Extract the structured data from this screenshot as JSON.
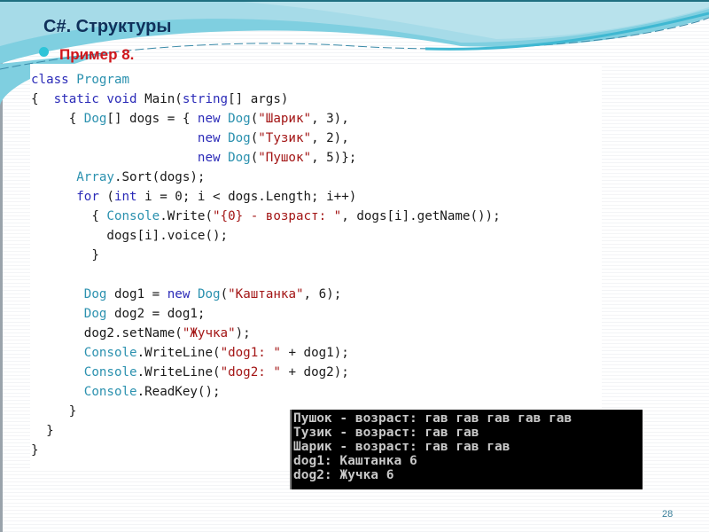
{
  "slide": {
    "title": "C#. Структуры",
    "subtitle": "Пример 8.",
    "page_number": "28",
    "colors": {
      "title": "#10305a",
      "subtitle": "#d0161b",
      "bullet": "#2ec4d8",
      "header_wave": "#7fcfe0"
    }
  },
  "code": {
    "lines": [
      [
        {
          "t": "class ",
          "c": "kw"
        },
        {
          "t": "Program",
          "c": "ty"
        }
      ],
      [
        {
          "t": "{  ",
          "c": ""
        },
        {
          "t": "static void ",
          "c": "kw"
        },
        {
          "t": "Main(",
          "c": ""
        },
        {
          "t": "string",
          "c": "kw"
        },
        {
          "t": "[] args)",
          "c": ""
        }
      ],
      [
        {
          "t": "     { ",
          "c": ""
        },
        {
          "t": "Dog",
          "c": "ty"
        },
        {
          "t": "[] dogs = { ",
          "c": ""
        },
        {
          "t": "new ",
          "c": "kw"
        },
        {
          "t": "Dog",
          "c": "ty"
        },
        {
          "t": "(",
          "c": ""
        },
        {
          "t": "\"Шарик\"",
          "c": "st"
        },
        {
          "t": ", 3),",
          "c": ""
        }
      ],
      [
        {
          "t": "                      ",
          "c": ""
        },
        {
          "t": "new ",
          "c": "kw"
        },
        {
          "t": "Dog",
          "c": "ty"
        },
        {
          "t": "(",
          "c": ""
        },
        {
          "t": "\"Тузик\"",
          "c": "st"
        },
        {
          "t": ", 2),",
          "c": ""
        }
      ],
      [
        {
          "t": "                      ",
          "c": ""
        },
        {
          "t": "new ",
          "c": "kw"
        },
        {
          "t": "Dog",
          "c": "ty"
        },
        {
          "t": "(",
          "c": ""
        },
        {
          "t": "\"Пушок\"",
          "c": "st"
        },
        {
          "t": ", 5)};",
          "c": ""
        }
      ],
      [
        {
          "t": "      ",
          "c": ""
        },
        {
          "t": "Array",
          "c": "ty"
        },
        {
          "t": ".Sort(dogs);",
          "c": ""
        }
      ],
      [
        {
          "t": "      ",
          "c": ""
        },
        {
          "t": "for ",
          "c": "kw"
        },
        {
          "t": "(",
          "c": ""
        },
        {
          "t": "int ",
          "c": "kw"
        },
        {
          "t": "i = 0; i < dogs.Length; i++)",
          "c": ""
        }
      ],
      [
        {
          "t": "        { ",
          "c": ""
        },
        {
          "t": "Console",
          "c": "ty"
        },
        {
          "t": ".Write(",
          "c": ""
        },
        {
          "t": "\"{0} - возраст: \"",
          "c": "st"
        },
        {
          "t": ", dogs[i].getName());",
          "c": ""
        }
      ],
      [
        {
          "t": "          dogs[i].voice();",
          "c": ""
        }
      ],
      [
        {
          "t": "        }",
          "c": ""
        }
      ],
      [
        {
          "t": "",
          "c": ""
        }
      ],
      [
        {
          "t": "       ",
          "c": ""
        },
        {
          "t": "Dog ",
          "c": "ty"
        },
        {
          "t": "dog1 = ",
          "c": ""
        },
        {
          "t": "new ",
          "c": "kw"
        },
        {
          "t": "Dog",
          "c": "ty"
        },
        {
          "t": "(",
          "c": ""
        },
        {
          "t": "\"Каштанка\"",
          "c": "st"
        },
        {
          "t": ", 6);",
          "c": ""
        }
      ],
      [
        {
          "t": "       ",
          "c": ""
        },
        {
          "t": "Dog ",
          "c": "ty"
        },
        {
          "t": "dog2 = dog1;",
          "c": ""
        }
      ],
      [
        {
          "t": "       dog2.setName(",
          "c": ""
        },
        {
          "t": "\"Жучка\"",
          "c": "st"
        },
        {
          "t": ");",
          "c": ""
        }
      ],
      [
        {
          "t": "       ",
          "c": ""
        },
        {
          "t": "Console",
          "c": "ty"
        },
        {
          "t": ".WriteLine(",
          "c": ""
        },
        {
          "t": "\"dog1: \"",
          "c": "st"
        },
        {
          "t": " + dog1);",
          "c": ""
        }
      ],
      [
        {
          "t": "       ",
          "c": ""
        },
        {
          "t": "Console",
          "c": "ty"
        },
        {
          "t": ".WriteLine(",
          "c": ""
        },
        {
          "t": "\"dog2: \"",
          "c": "st"
        },
        {
          "t": " + dog2);",
          "c": ""
        }
      ],
      [
        {
          "t": "       ",
          "c": ""
        },
        {
          "t": "Console",
          "c": "ty"
        },
        {
          "t": ".ReadKey();",
          "c": ""
        }
      ],
      [
        {
          "t": "     }",
          "c": ""
        }
      ],
      [
        {
          "t": "  }",
          "c": ""
        }
      ],
      [
        {
          "t": "}",
          "c": ""
        }
      ]
    ]
  },
  "console_output": {
    "lines": [
      "Пушок - возраст: гав гав гав гав гав",
      "Тузик - возраст: гав гав",
      "Шарик - возраст: гав гав гав",
      "dog1: Каштанка 6",
      "dog2: Жучка 6"
    ]
  }
}
